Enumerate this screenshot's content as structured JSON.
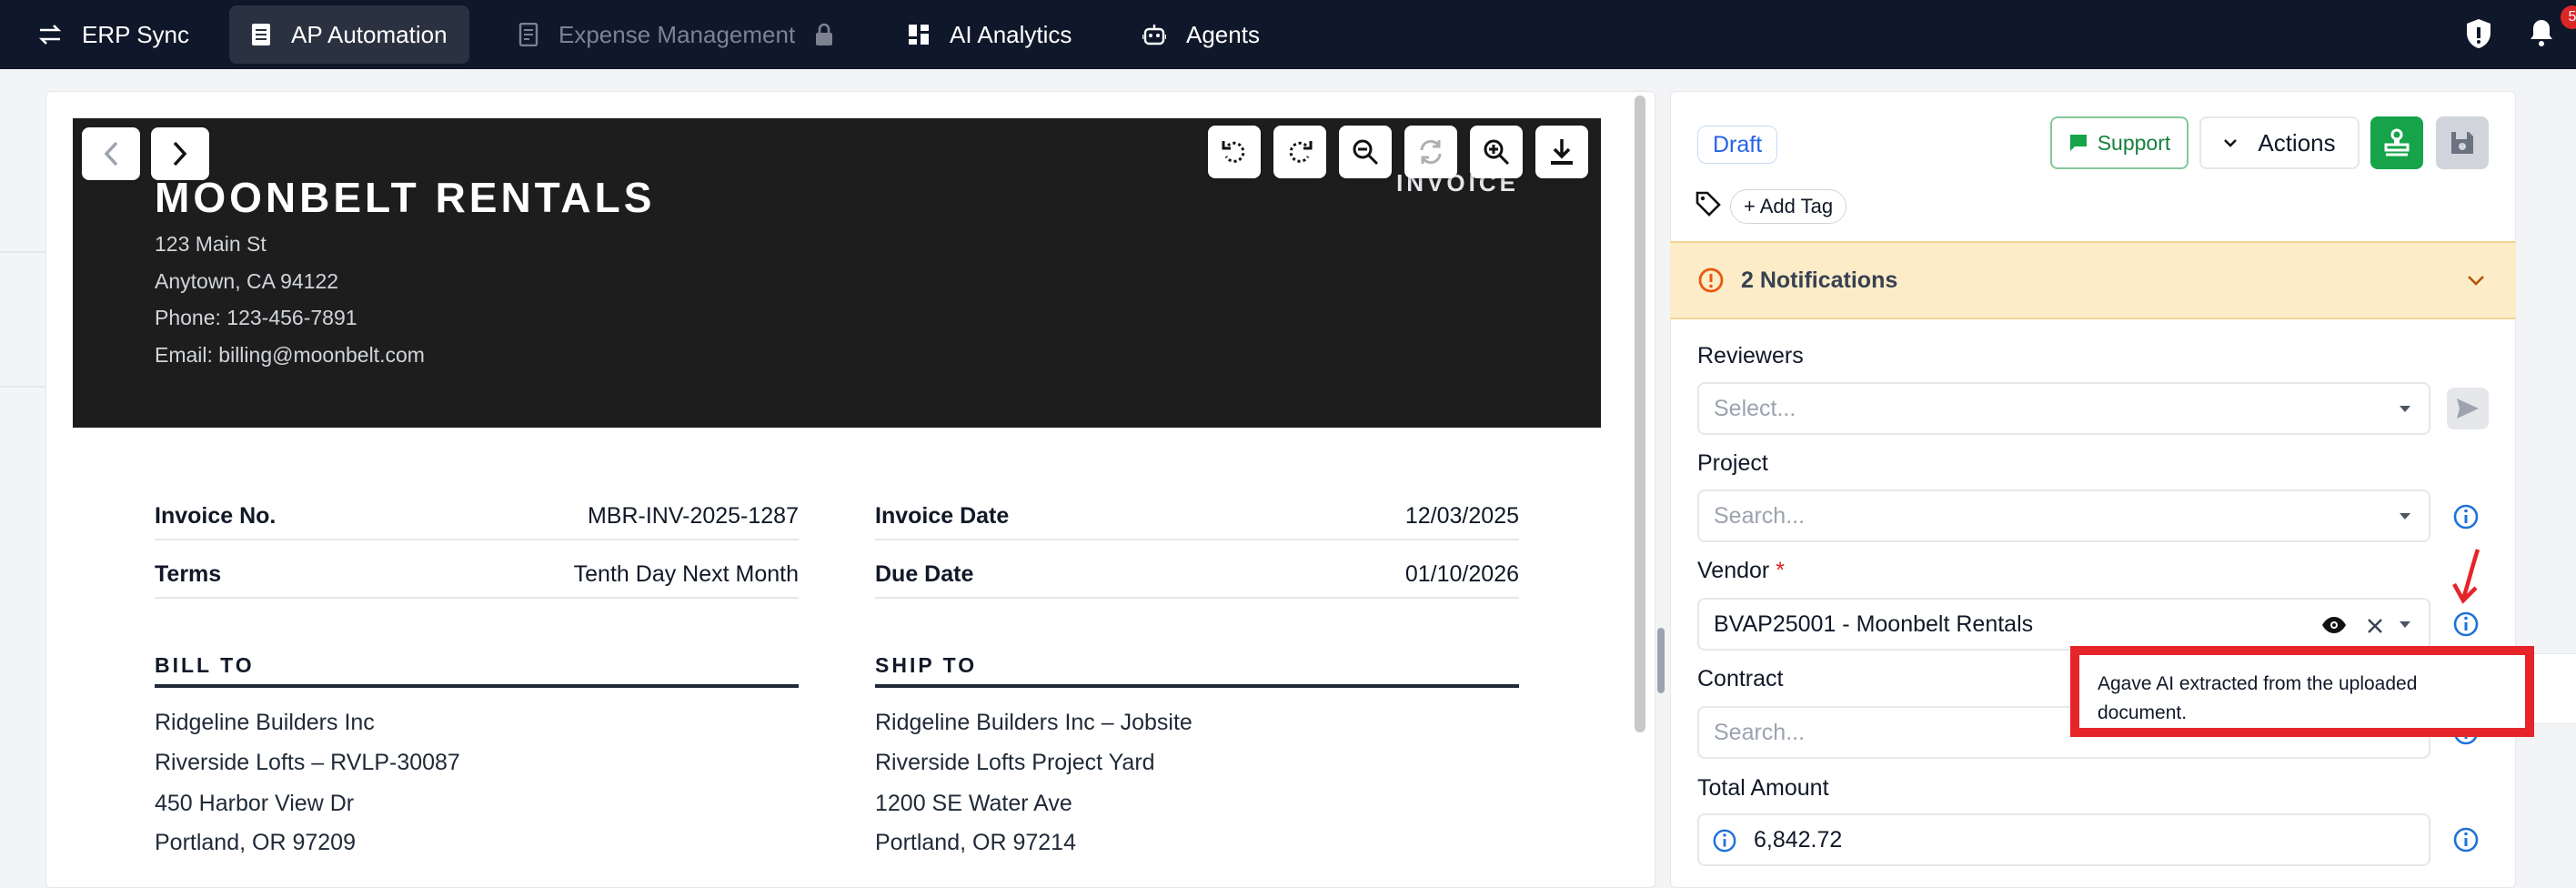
{
  "nav": {
    "items": [
      {
        "label": "ERP Sync",
        "icon": "sync-arrows-icon"
      },
      {
        "label": "AP Automation",
        "icon": "document-icon",
        "active": true
      },
      {
        "label": "Expense Management",
        "icon": "receipt-icon",
        "locked": true
      },
      {
        "label": "AI Analytics",
        "icon": "dashboard-icon"
      },
      {
        "label": "Agents",
        "icon": "robot-icon"
      }
    ],
    "notification_count": "5"
  },
  "invoice": {
    "company_name": "MOONBELT RENTALS",
    "address_line1": "123 Main St",
    "address_line2": "Anytown, CA 94122",
    "phone": "Phone: 123-456-7891",
    "email": "Email: billing@moonbelt.com",
    "doc_label": "INVOICE",
    "fields": {
      "invoice_no_label": "Invoice No.",
      "invoice_no": "MBR-INV-2025-1287",
      "terms_label": "Terms",
      "terms": "Tenth Day Next Month",
      "invoice_date_label": "Invoice Date",
      "invoice_date": "12/03/2025",
      "due_date_label": "Due Date",
      "due_date": "01/10/2026"
    },
    "bill_to": {
      "heading": "BILL TO",
      "lines": [
        "Ridgeline Builders Inc",
        "Riverside Lofts – RVLP-30087",
        "450 Harbor View Dr",
        "Portland, OR 97209"
      ]
    },
    "ship_to": {
      "heading": "SHIP TO",
      "lines": [
        "Ridgeline Builders Inc – Jobsite",
        "Riverside Lofts Project Yard",
        "1200 SE Water Ave",
        "Portland, OR 97214"
      ]
    }
  },
  "side": {
    "status": "Draft",
    "support_label": "Support",
    "actions_label": "Actions",
    "add_tag_label": "+ Add Tag",
    "notifications_label": "2 Notifications",
    "reviewers_label": "Reviewers",
    "reviewers_placeholder": "Select...",
    "project_label": "Project",
    "project_placeholder": "Search...",
    "vendor_label": "Vendor",
    "vendor_required": "*",
    "vendor_value": "BVAP25001 - Moonbelt Rentals",
    "contract_label": "Contract",
    "contract_placeholder": "Search...",
    "total_label": "Total Amount",
    "total_value": "6,842.72",
    "tooltip": "Agave AI extracted from the uploaded document."
  },
  "colors": {
    "nav_bg": "#0f172a",
    "accent_green": "#16a34a",
    "accent_blue": "#2563eb",
    "highlight_red": "#e5252a",
    "notification_bg": "#fdecc8"
  }
}
